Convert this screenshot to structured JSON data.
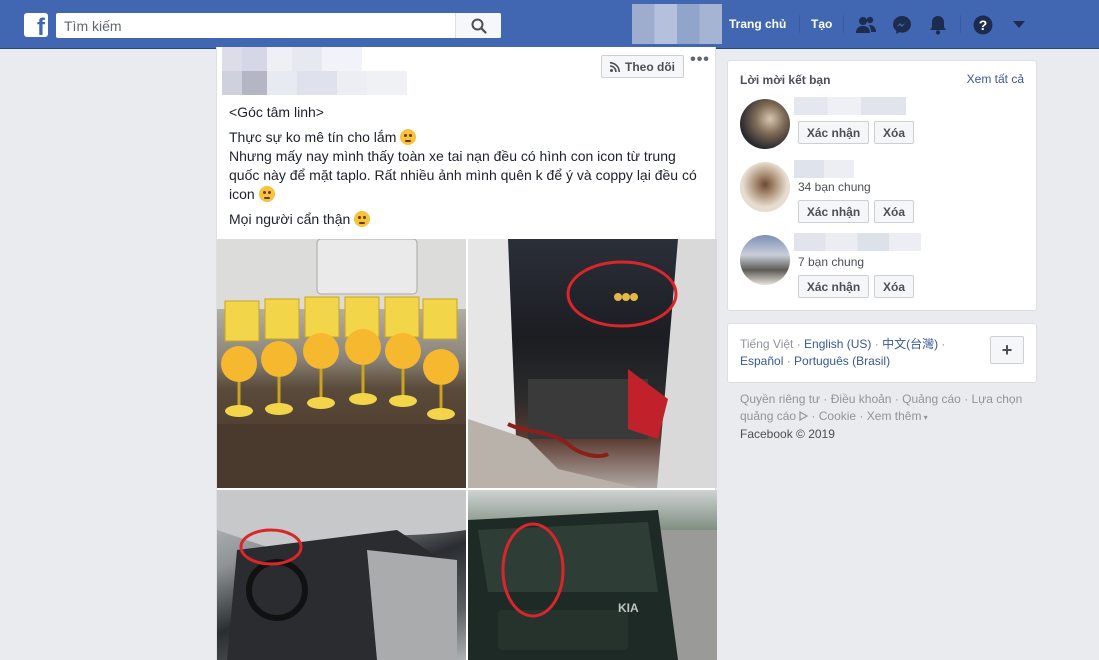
{
  "topbar": {
    "search_placeholder": "Tìm kiếm",
    "nav_home": "Trang chủ",
    "nav_create": "Tạo"
  },
  "post": {
    "follow_label": "Theo dõi",
    "more_label": "•••",
    "line1": "<Góc tâm linh>",
    "line2": "Thực sự ko mê tín cho lắm",
    "line3": "Nhưng mấy nay mình thấy toàn xe tai nạn đều có hình con icon từ trung quốc này để mặt taplo. Rất nhiều ảnh mình quên k để ý và coppy lại đều có icon",
    "line4": "Mọi người cẩn thận"
  },
  "friend_requests": {
    "title": "Lời mời kết bạn",
    "see_all": "Xem tất cả",
    "confirm_label": "Xác nhận",
    "delete_label": "Xóa",
    "items": [
      {
        "mutual": ""
      },
      {
        "mutual": "34 bạn chung"
      },
      {
        "mutual": "7 bạn chung"
      }
    ]
  },
  "languages": {
    "current": "Tiếng Việt",
    "items": [
      "English (US)",
      "中文(台灣)",
      "Español",
      "Português (Brasil)"
    ]
  },
  "footer": {
    "privacy": "Quyền riêng tư",
    "terms": "Điều khoản",
    "ads": "Quảng cáo",
    "ad_choices": "Lựa chọn quảng cáo",
    "cookie": "Cookie",
    "more": "Xem thêm",
    "copyright": "Facebook © 2019"
  }
}
